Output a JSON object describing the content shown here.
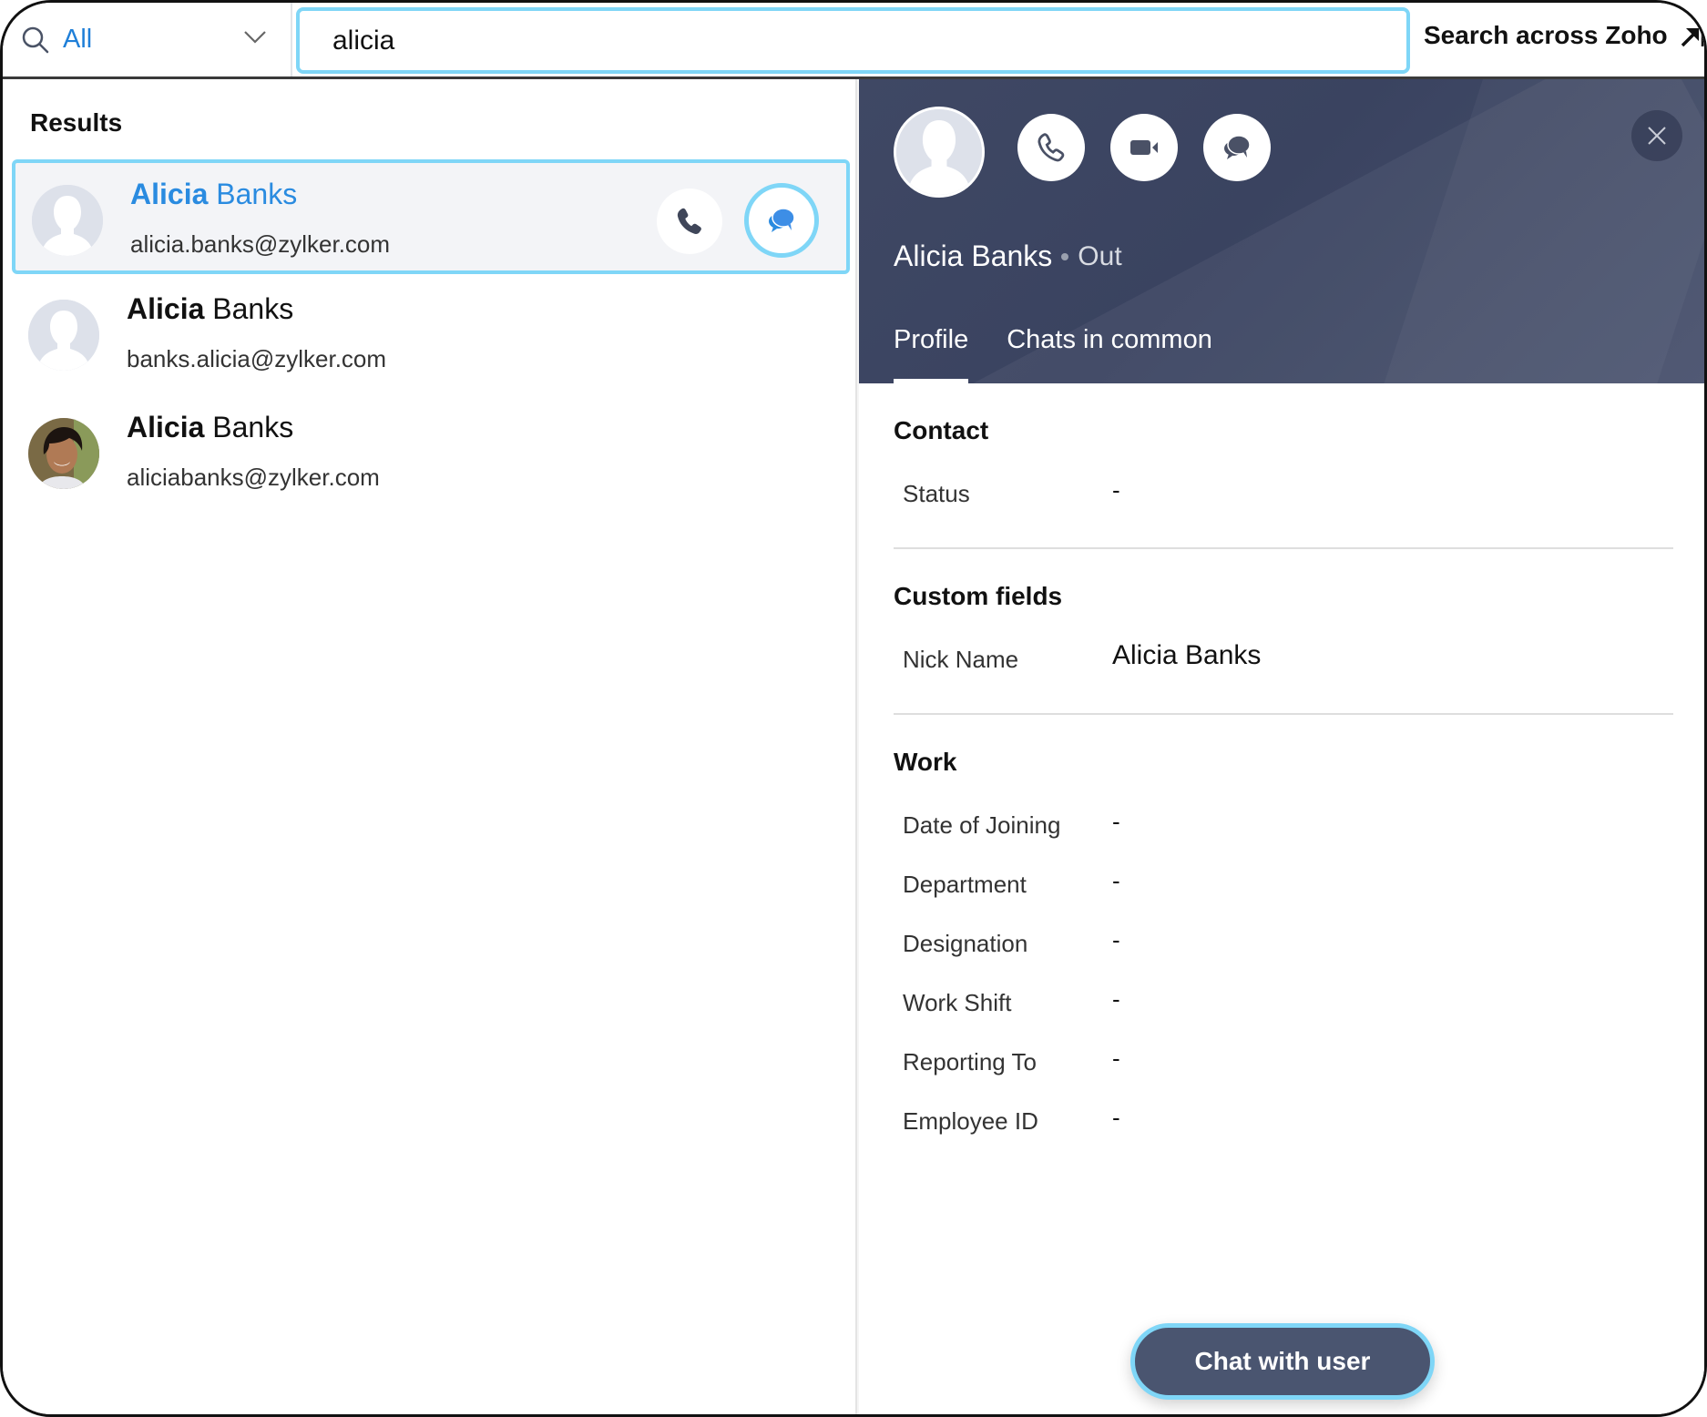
{
  "search": {
    "scope_label": "All",
    "query": "alicia",
    "search_across_label": "Search across Zoho"
  },
  "results": {
    "title": "Results",
    "items": [
      {
        "name_match": "Alicia",
        "name_rest": " Banks",
        "email": "alicia.banks@zylker.com",
        "selected": true,
        "avatar": "placeholder"
      },
      {
        "name_match": "Alicia",
        "name_rest": " Banks",
        "email": "banks.alicia@zylker.com",
        "selected": false,
        "avatar": "placeholder"
      },
      {
        "name_match": "Alicia",
        "name_rest": " Banks",
        "email": "aliciabanks@zylker.com",
        "selected": false,
        "avatar": "photo"
      }
    ]
  },
  "profile": {
    "name": "Alicia Banks",
    "status": "Out",
    "tabs": [
      {
        "label": "Profile",
        "active": true
      },
      {
        "label": "Chats in common",
        "active": false
      }
    ],
    "sections": {
      "contact": {
        "title": "Contact",
        "fields": [
          {
            "label": "Status",
            "value": "-"
          }
        ]
      },
      "custom": {
        "title": "Custom fields",
        "fields": [
          {
            "label": "Nick Name",
            "value": "Alicia Banks"
          }
        ]
      },
      "work": {
        "title": "Work",
        "fields": [
          {
            "label": "Date of Joining",
            "value": "-"
          },
          {
            "label": "Department",
            "value": "-"
          },
          {
            "label": "Designation",
            "value": "-"
          },
          {
            "label": "Work Shift",
            "value": "-"
          },
          {
            "label": "Reporting To",
            "value": "-"
          },
          {
            "label": "Employee ID",
            "value": "-"
          }
        ]
      }
    },
    "cta_label": "Chat with user"
  },
  "icons": {
    "search": "search-icon",
    "chevron": "chevron-down-icon",
    "external": "external-link-icon",
    "phone": "phone-icon",
    "video": "video-icon",
    "chat": "chat-bubbles-icon",
    "close": "close-icon"
  },
  "colors": {
    "accent_blue": "#2a8be0",
    "focus_ring": "#7fd6f7",
    "hero_bg": "#3f4864",
    "cta_bg": "#4a5570"
  }
}
